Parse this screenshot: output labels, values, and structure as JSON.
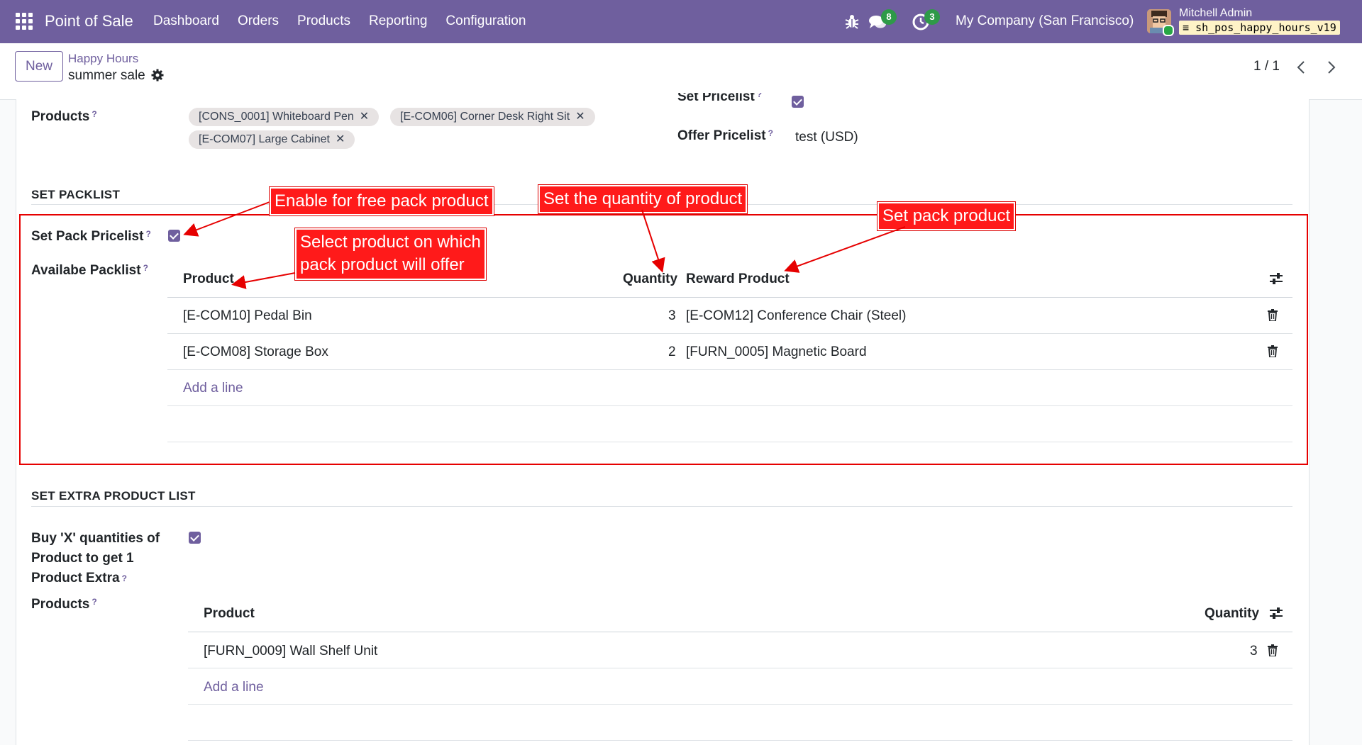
{
  "navbar": {
    "brand": "Point of Sale",
    "menu": [
      "Dashboard",
      "Orders",
      "Products",
      "Reporting",
      "Configuration"
    ],
    "messages_count": "8",
    "activities_count": "3",
    "company": "My Company (San Francisco)",
    "user_name": "Mitchell Admin",
    "database": "sh_pos_happy_hours_v19"
  },
  "control": {
    "new_label": "New",
    "breadcrumb_parent": "Happy Hours",
    "record_name": "summer sale",
    "pager": "1 / 1"
  },
  "top": {
    "products_label": "Products",
    "product_tags": [
      "[CONS_0001] Whiteboard Pen",
      "[E-COM06] Corner Desk Right Sit",
      "[E-COM07] Large Cabinet"
    ],
    "set_pricelist_label": "Set Pricelist",
    "set_pricelist_checked": true,
    "offer_pricelist_label": "Offer Pricelist",
    "offer_pricelist_value": "test (USD)"
  },
  "packlist": {
    "section_title": "SET PACKLIST",
    "set_pack_pricelist_label": "Set Pack Pricelist",
    "set_pack_pricelist_checked": true,
    "available_label": "Availabe Packlist",
    "columns": {
      "product": "Product",
      "quantity": "Quantity",
      "reward": "Reward Product"
    },
    "rows": [
      {
        "product": "[E-COM10] Pedal Bin",
        "quantity": "3",
        "reward": "[E-COM12] Conference Chair (Steel)"
      },
      {
        "product": "[E-COM08] Storage Box",
        "quantity": "2",
        "reward": "[FURN_0005] Magnetic Board"
      }
    ],
    "add_line": "Add a line"
  },
  "extra": {
    "section_title": "SET EXTRA PRODUCT LIST",
    "buy_label_lines": [
      "Buy 'X' quantities of",
      "Product to get 1",
      "Product Extra"
    ],
    "buy_checked": true,
    "products_label": "Products",
    "columns": {
      "product": "Product",
      "quantity": "Quantity"
    },
    "rows": [
      {
        "product": "[FURN_0009] Wall Shelf Unit",
        "quantity": "3"
      }
    ],
    "add_line": "Add a line"
  },
  "annotations": {
    "enable_free": "Enable for free pack product",
    "set_quantity": "Set the quantity of product",
    "set_pack": "Set pack product",
    "select_product_lines": [
      "Select product on which",
      "pack product will offer"
    ]
  },
  "colors": {
    "navbar": "#6f5f9e",
    "accent": "#6f5f9e",
    "annotation": "#ff1a1a",
    "badge": "#2e9a48"
  }
}
